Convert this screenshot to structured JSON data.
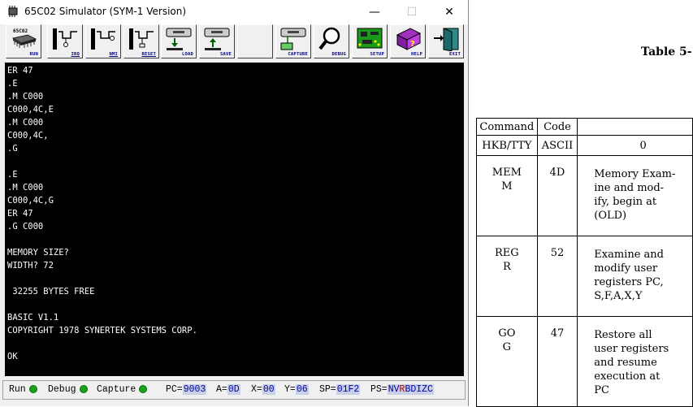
{
  "window": {
    "title": "65C02 Simulator (SYM-1 Version)",
    "controls": {
      "minimize": "—",
      "maximize": "☐",
      "close": "✕"
    }
  },
  "toolbar": [
    {
      "id": "run",
      "icon": "chip-icon",
      "label": "RUN",
      "chip_text": "65C02"
    },
    {
      "id": "irq",
      "icon": "irq-signal-icon",
      "label": "IRQ"
    },
    {
      "id": "nmi",
      "icon": "nmi-signal-icon",
      "label": "NMI"
    },
    {
      "id": "reset",
      "icon": "reset-signal-icon",
      "label": "RESET"
    },
    {
      "id": "load",
      "icon": "tape-load-icon",
      "label": "LOAD"
    },
    {
      "id": "save",
      "icon": "tape-save-icon",
      "label": "SAVE"
    },
    {
      "id": "blank",
      "icon": "",
      "label": ""
    },
    {
      "id": "capture",
      "icon": "capture-icon",
      "label": "CAPTURE"
    },
    {
      "id": "debug",
      "icon": "magnifier-icon",
      "label": "DEBUG"
    },
    {
      "id": "setup",
      "icon": "circuit-board-icon",
      "label": "SETUP"
    },
    {
      "id": "help",
      "icon": "help-book-icon",
      "label": "HELP"
    },
    {
      "id": "exit",
      "icon": "exit-door-icon",
      "label": "EXIT"
    }
  ],
  "terminal": {
    "lines": [
      "ER 47",
      ".E",
      ".M C000",
      "C000,4C,E",
      ".M C000",
      "C000,4C,",
      ".G",
      "",
      ".E",
      ".M C000",
      "C000,4C,G",
      "ER 47",
      ".G C000",
      "",
      "MEMORY SIZE?",
      "WIDTH? 72",
      "",
      " 32255 BYTES FREE",
      "",
      "BASIC V1.1",
      "COPYRIGHT 1978 SYNERTEK SYSTEMS CORP.",
      "",
      "OK"
    ]
  },
  "status": {
    "run": "Run",
    "debug": "Debug",
    "capture": "Capture",
    "pc_label": "PC=",
    "pc": "9003",
    "a_label": "A=",
    "a": "0D",
    "x_label": "X=",
    "x": "00",
    "y_label": "Y=",
    "y": "06",
    "sp_label": "SP=",
    "sp": "01F2",
    "ps_label": "PS=",
    "ps_a": "NV",
    "ps_b": "R",
    "ps_c": "BDIZC",
    "led_color": "#1aa31a"
  },
  "document": {
    "table_title": "Table 5-",
    "headers": {
      "command": "Command",
      "code": "Code"
    },
    "rows": [
      {
        "command": "HKB/TTY",
        "code": "ASCII",
        "desc": "0"
      },
      {
        "command": "MEM\nM",
        "code": "4D",
        "desc": "Memory Exam-\nine and mod-\nify, begin at\n(OLD)"
      },
      {
        "command": "REG\nR",
        "code": "52",
        "desc": "Examine and\nmodify user\nregisters PC,\nS,F,A,X,Y"
      },
      {
        "command": "GO\nG",
        "code": "47",
        "desc": "Restore all\nuser registers\nand resume\nexecution at\nPC"
      }
    ]
  }
}
